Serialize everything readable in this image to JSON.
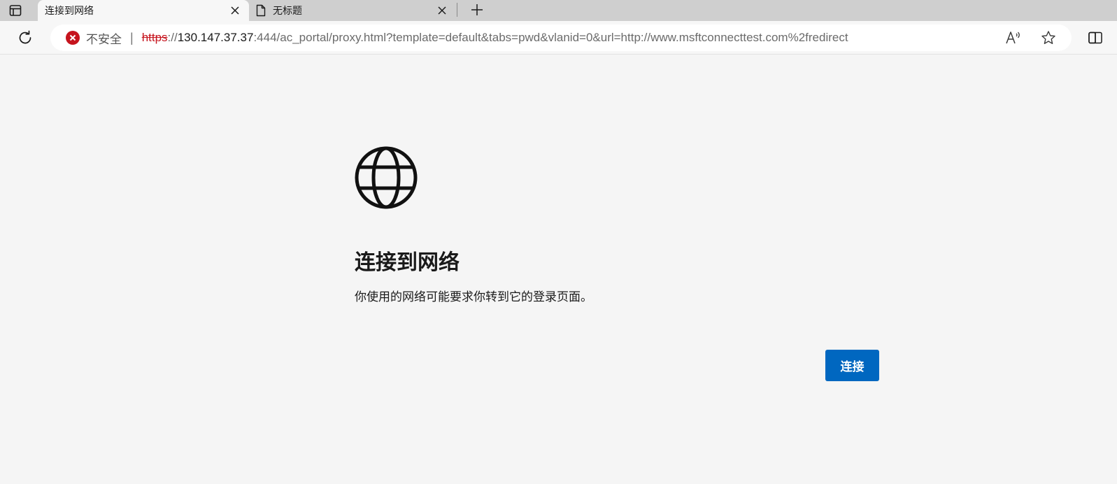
{
  "tabs": [
    {
      "title": "连接到网络",
      "active": true
    },
    {
      "title": "无标题",
      "active": false
    }
  ],
  "addressbar": {
    "security_label": "不安全",
    "separator": "|",
    "url_scheme": "https",
    "url_scheme_sep": "://",
    "url_host": "130.147.37.37",
    "url_rest": ":444/ac_portal/proxy.html?template=default&tabs=pwd&vlanid=0&url=http://www.msftconnecttest.com%2fredirect"
  },
  "icons": {
    "tab_actions": "tab-actions-icon",
    "page": "page-icon",
    "close": "close-icon",
    "new_tab": "plus-icon",
    "refresh": "refresh-icon",
    "not_secure": "error-x-icon",
    "read_aloud": "read-aloud-icon",
    "favorite": "star-icon",
    "split_screen": "split-screen-icon",
    "globe": "globe-icon"
  },
  "colors": {
    "accent": "#0067c0",
    "danger": "#c6141e",
    "background": "#f5f5f5"
  },
  "page": {
    "heading": "连接到网络",
    "description": "你使用的网络可能要求你转到它的登录页面。",
    "connect_button": "连接"
  }
}
